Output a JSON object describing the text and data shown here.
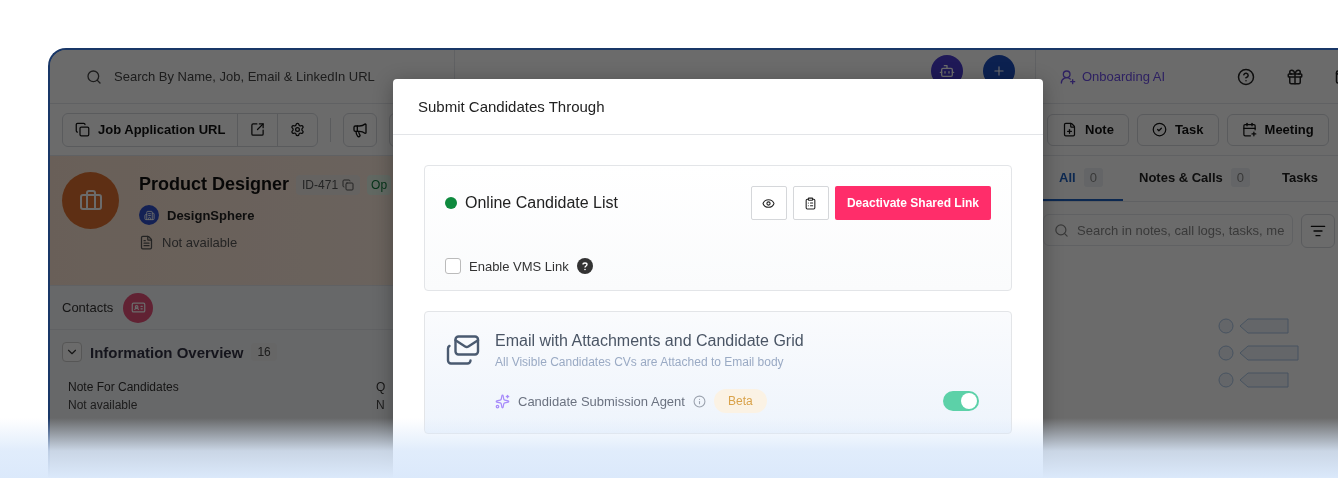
{
  "search": {
    "placeholder": "Search By Name, Job, Email & LinkedIn URL"
  },
  "topbar": {
    "onboarding": "Onboarding AI"
  },
  "toolbar": {
    "job_url": "Job Application URL"
  },
  "job": {
    "title": "Product Designer",
    "id": "ID-471",
    "status": "Op",
    "company": "DesignSphere",
    "description": "Not available"
  },
  "contacts": {
    "label": "Contacts"
  },
  "overview": {
    "title": "Information Overview",
    "count": "16",
    "expanded": true
  },
  "fields": [
    {
      "label": "Note For Candidates",
      "value": "Not available"
    },
    {
      "label": "Q",
      "value": "N"
    }
  ],
  "actions": [
    {
      "kind": "note",
      "label": "Note"
    },
    {
      "kind": "task",
      "label": "Task"
    },
    {
      "kind": "meeting",
      "label": "Meeting"
    }
  ],
  "activity_tabs": [
    {
      "label": "All",
      "count": "0",
      "selected": true
    },
    {
      "label": "Notes & Calls",
      "count": "0",
      "selected": false
    },
    {
      "label": "Tasks",
      "selected": false
    }
  ],
  "activity_search": {
    "placeholder": "Search in notes, call logs, tasks, me"
  },
  "modal": {
    "title": "Submit Candidates Through",
    "online_list": {
      "title": "Online Candidate List",
      "active": true,
      "deactivate_button": "Deactivate Shared Link",
      "vms": {
        "label": "Enable VMS Link",
        "checked": false
      }
    },
    "email": {
      "title": "Email with Attachments and Candidate Grid",
      "subtitle": "All Visible Candidates CVs are Attached to Email body",
      "agent": {
        "label": "Candidate Submission Agent",
        "badge": "Beta",
        "on": true
      }
    }
  }
}
